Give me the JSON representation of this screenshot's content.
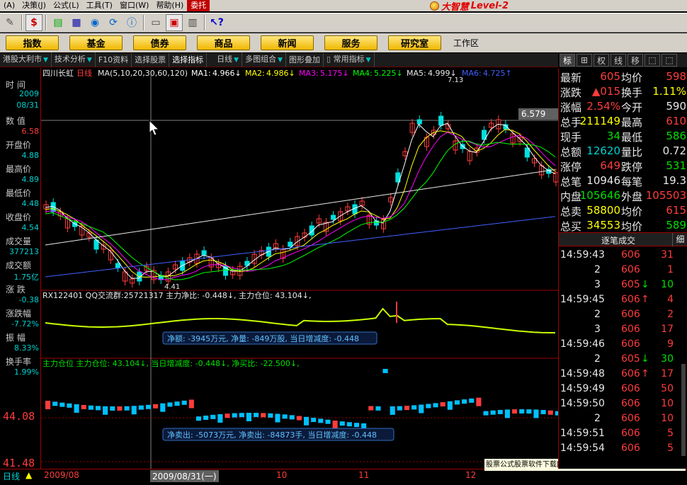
{
  "menu": {
    "items": [
      "(A)",
      "决策(J)",
      "公式(L)",
      "工具(T)",
      "窗口(W)",
      "帮助(H)",
      "委托"
    ],
    "active_index": 6
  },
  "brand": {
    "name": "大智慧",
    "edition": "Level-2"
  },
  "nav_buttons": [
    "指数",
    "基金",
    "债券",
    "商品",
    "新闻",
    "服务",
    "研究室"
  ],
  "workarea_label": "工作区",
  "subbar": [
    "港股大利市",
    "技术分析",
    "F10资料",
    "选择股票",
    "选择指标",
    "日线",
    "多图组合",
    "图形叠加",
    "常用指标"
  ],
  "right_tabs": [
    "标",
    "⊞",
    "权",
    "线",
    "移",
    "⬚",
    "⬚"
  ],
  "left_panel": [
    {
      "label": "时 间",
      "value": "2009",
      "value2": "08/31",
      "color": "#00d0d0"
    },
    {
      "label": "数 值",
      "value": "6.58",
      "color": "#ff3c3c"
    },
    {
      "label": "开盘价",
      "value": "4.88",
      "color": "#00d0d0"
    },
    {
      "label": "最高价",
      "value": "4.89",
      "color": "#00d0d0"
    },
    {
      "label": "最低价",
      "value": "4.48",
      "color": "#00d0d0"
    },
    {
      "label": "收盘价",
      "value": "4.54",
      "color": "#00d0d0"
    },
    {
      "label": "成交量",
      "value": "377213",
      "color": "#00d0d0"
    },
    {
      "label": "成交额",
      "value": "1.75亿",
      "color": "#00d0d0"
    },
    {
      "label": "涨 跌",
      "value": "-0.38",
      "color": "#00d0d0"
    },
    {
      "label": "涨跌幅",
      "value": "-7.72%",
      "color": "#00d0d0"
    },
    {
      "label": "振 幅",
      "value": "8.33%",
      "color": "#00d0d0"
    },
    {
      "label": "换手率",
      "value": "1.99%",
      "color": "#00d0d0"
    }
  ],
  "chart": {
    "stock_name": "四川长虹",
    "period": "日线",
    "ma_spec": "MA(5,10,20,30,60,120)",
    "ma": [
      {
        "label": "MA1:",
        "value": "4.966↓",
        "color": "#ffffff"
      },
      {
        "label": "MA2:",
        "value": "4.986↓",
        "color": "#ffff00"
      },
      {
        "label": "MA3:",
        "value": "5.175↓",
        "color": "#ff00ff"
      },
      {
        "label": "MA4:",
        "value": "5.225↓",
        "color": "#00ff00"
      },
      {
        "label": "MA5:",
        "value": "4.999↓",
        "color": "#e8e8e8"
      },
      {
        "label": "MA6:",
        "value": "4.725↑",
        "color": "#4060ff"
      }
    ],
    "high_label": "7.13",
    "low_label": "4.41",
    "price_tag": "6.579",
    "p2_title": "RX122401  QQ交流群:25721317  主力净比: -0.448↓, 主力仓位: 43.104↓,",
    "p2_tip": "净额: -3945万元, 净量: -849万股, 当日增减度: -0.448",
    "p3_title": "主力仓位  主力仓位: 43.104↓, 当日增减度: -0.448↓, 净买比: -22.500↓,",
    "p3_tip": "净卖出: -5073万元, 净卖出: -84873手, 当日增减度: -0.448",
    "p3_axis": [
      "44.08",
      "41.48"
    ]
  },
  "chart_data": {
    "type": "candlestick",
    "title": "四川长虹 日线",
    "x": [
      "2009/08",
      "10",
      "11",
      "12"
    ],
    "price_high": 7.13,
    "price_low": 4.41
  },
  "bottom": {
    "period": "日线",
    "date_left": "2009/08",
    "cursor_date": "2009/08/31(一)",
    "m10": "10",
    "m11": "11",
    "m12": "12",
    "ad": "股票公式股票软件下载[分析家公式网]www.88gs.com"
  },
  "quote": [
    {
      "l1": "最新",
      "v1": "605",
      "c1": "#ff3c3c",
      "l2": "均价",
      "v2": "598",
      "c2": "#ff3c3c"
    },
    {
      "l1": "涨跌",
      "v1": "▲015",
      "c1": "#ff3c3c",
      "l2": "换手",
      "v2": "1.11%",
      "c2": "#ffff00"
    },
    {
      "l1": "涨幅",
      "v1": "2.54%",
      "c1": "#ff3c3c",
      "l2": "今开",
      "v2": "590",
      "c2": "#e8e8e8"
    },
    {
      "l1": "总手",
      "v1": "211149",
      "c1": "#ffff00",
      "l2": "最高",
      "v2": "610",
      "c2": "#ff3c3c"
    },
    {
      "l1": "现手",
      "v1": "34",
      "c1": "#00e000",
      "l2": "最低",
      "v2": "586",
      "c2": "#00e000"
    },
    {
      "l1": "总额",
      "v1": "12620",
      "c1": "#00d0d0",
      "l2": "量比",
      "v2": "0.72",
      "c2": "#e8e8e8"
    },
    {
      "l1": "涨停",
      "v1": "649",
      "c1": "#ff3c3c",
      "l2": "跌停",
      "v2": "531",
      "c2": "#00e000"
    },
    {
      "l1": "总笔",
      "v1": "10946",
      "c1": "#e8e8e8",
      "l2": "每笔",
      "v2": "19.3",
      "c2": "#e8e8e8"
    },
    {
      "l1": "内盘",
      "v1": "105646",
      "c1": "#00e000",
      "l2": "外盘",
      "v2": "105503",
      "c2": "#ff3c3c"
    },
    {
      "l1": "总卖",
      "v1": "58800",
      "c1": "#ffff00",
      "l2": "均价",
      "v2": "615",
      "c2": "#ff3c3c"
    },
    {
      "l1": "总买",
      "v1": "34553",
      "c1": "#ffff00",
      "l2": "均价",
      "v2": "589",
      "c2": "#00e000"
    }
  ],
  "ticks_title": "逐笔成交",
  "ticks_tab": "细",
  "ticks": [
    {
      "t": "14:59:43",
      "p": "606",
      "pc": "#ff3c3c",
      "a": "",
      "v": "31",
      "vc": "#ff3c3c"
    },
    {
      "t": "2",
      "p": "606",
      "pc": "#ff3c3c",
      "a": "",
      "v": "1",
      "vc": "#ff3c3c"
    },
    {
      "t": "3",
      "p": "605",
      "pc": "#ff3c3c",
      "a": "↓",
      "v": "10",
      "vc": "#00e000"
    },
    {
      "t": "14:59:45",
      "p": "606",
      "pc": "#ff3c3c",
      "a": "↑",
      "v": "4",
      "vc": "#ff3c3c"
    },
    {
      "t": "2",
      "p": "606",
      "pc": "#ff3c3c",
      "a": "",
      "v": "2",
      "vc": "#ff3c3c"
    },
    {
      "t": "3",
      "p": "606",
      "pc": "#ff3c3c",
      "a": "",
      "v": "17",
      "vc": "#ff3c3c"
    },
    {
      "t": "14:59:46",
      "p": "606",
      "pc": "#ff3c3c",
      "a": "",
      "v": "9",
      "vc": "#ff3c3c"
    },
    {
      "t": "2",
      "p": "605",
      "pc": "#ff3c3c",
      "a": "↓",
      "v": "30",
      "vc": "#00e000"
    },
    {
      "t": "14:59:48",
      "p": "606",
      "pc": "#ff3c3c",
      "a": "↑",
      "v": "17",
      "vc": "#ff3c3c"
    },
    {
      "t": "14:59:49",
      "p": "606",
      "pc": "#ff3c3c",
      "a": "",
      "v": "50",
      "vc": "#ff3c3c"
    },
    {
      "t": "14:59:50",
      "p": "606",
      "pc": "#ff3c3c",
      "a": "",
      "v": "10",
      "vc": "#ff3c3c"
    },
    {
      "t": "2",
      "p": "606",
      "pc": "#ff3c3c",
      "a": "",
      "v": "10",
      "vc": "#ff3c3c"
    },
    {
      "t": "14:59:51",
      "p": "606",
      "pc": "#ff3c3c",
      "a": "",
      "v": "5",
      "vc": "#ff3c3c"
    },
    {
      "t": "14:59:54",
      "p": "606",
      "pc": "#ff3c3c",
      "a": "",
      "v": "5",
      "vc": "#ff3c3c"
    }
  ]
}
